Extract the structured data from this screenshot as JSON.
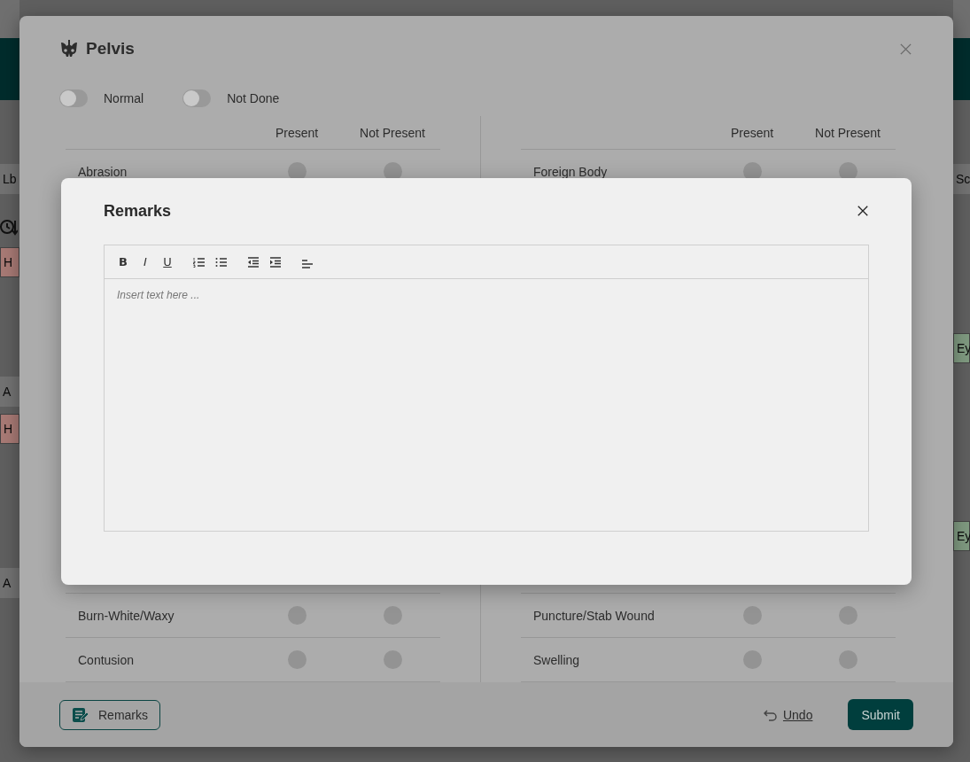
{
  "background": {
    "left": [
      {
        "kind": "text",
        "text": "Lb"
      },
      {
        "kind": "history-icon"
      },
      {
        "kind": "tag",
        "text": "H",
        "color": "#a87a75"
      },
      {
        "kind": "text",
        "text": "A"
      },
      {
        "kind": "tag",
        "text": "H",
        "color": "#a87a75"
      },
      {
        "kind": "text",
        "text": "A"
      }
    ],
    "right": [
      {
        "kind": "text",
        "text": "Sc"
      },
      {
        "kind": "tag",
        "text": "Ey",
        "color": "#7f9a80"
      },
      {
        "kind": "tag",
        "text": "Ey",
        "color": "#7f9a80"
      }
    ]
  },
  "dialog": {
    "title": "Pelvis",
    "toggles": [
      {
        "label": "Normal",
        "on": false
      },
      {
        "label": "Not Done",
        "on": false
      }
    ],
    "panels": [
      {
        "columns": [
          "Present",
          "Not Present"
        ],
        "rows": [
          {
            "label": "Abrasion",
            "present": false,
            "not_present": false
          }
        ],
        "rows_after": [
          {
            "label": "Burn-White/Waxy",
            "present": false,
            "not_present": false
          },
          {
            "label": "Contusion",
            "present": false,
            "not_present": false
          }
        ]
      },
      {
        "columns": [
          "Present",
          "Not Present"
        ],
        "rows": [
          {
            "label": "Foreign Body",
            "present": false,
            "not_present": false
          }
        ],
        "rows_after": [
          {
            "label": "Puncture/Stab Wound",
            "present": false,
            "not_present": false
          },
          {
            "label": "Swelling",
            "present": false,
            "not_present": false
          }
        ]
      }
    ],
    "footer": {
      "remarks_button": "Remarks",
      "undo": "Undo",
      "submit": "Submit"
    }
  },
  "remarks_dialog": {
    "title": "Remarks",
    "toolbar": [
      [
        {
          "kind": "char",
          "label": "B"
        },
        {
          "kind": "char",
          "label": "I"
        },
        {
          "kind": "char",
          "label": "U"
        }
      ],
      [
        {
          "kind": "ordered-list"
        },
        {
          "kind": "bullet-list"
        }
      ],
      [
        {
          "kind": "outdent"
        },
        {
          "kind": "indent"
        }
      ],
      [
        {
          "kind": "align-left"
        }
      ]
    ],
    "placeholder": "Insert text here ..."
  }
}
